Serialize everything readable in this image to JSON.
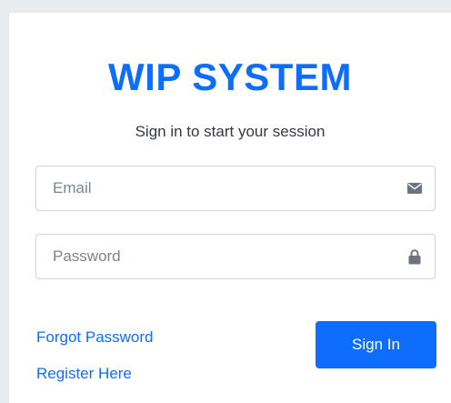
{
  "login": {
    "logo_text": "WIP SYSTEM",
    "subtitle": "Sign in to start your session",
    "email": {
      "placeholder": "Email",
      "value": "",
      "icon": "envelope-icon"
    },
    "password": {
      "placeholder": "Password",
      "value": "",
      "icon": "lock-icon"
    },
    "forgot_password_label": "Forgot Password",
    "register_label": "Register Here",
    "sign_in_label": "Sign In"
  },
  "colors": {
    "accent": "#0d6efd",
    "background": "#e9ecef",
    "card": "#ffffff",
    "icon": "#6c757d"
  }
}
